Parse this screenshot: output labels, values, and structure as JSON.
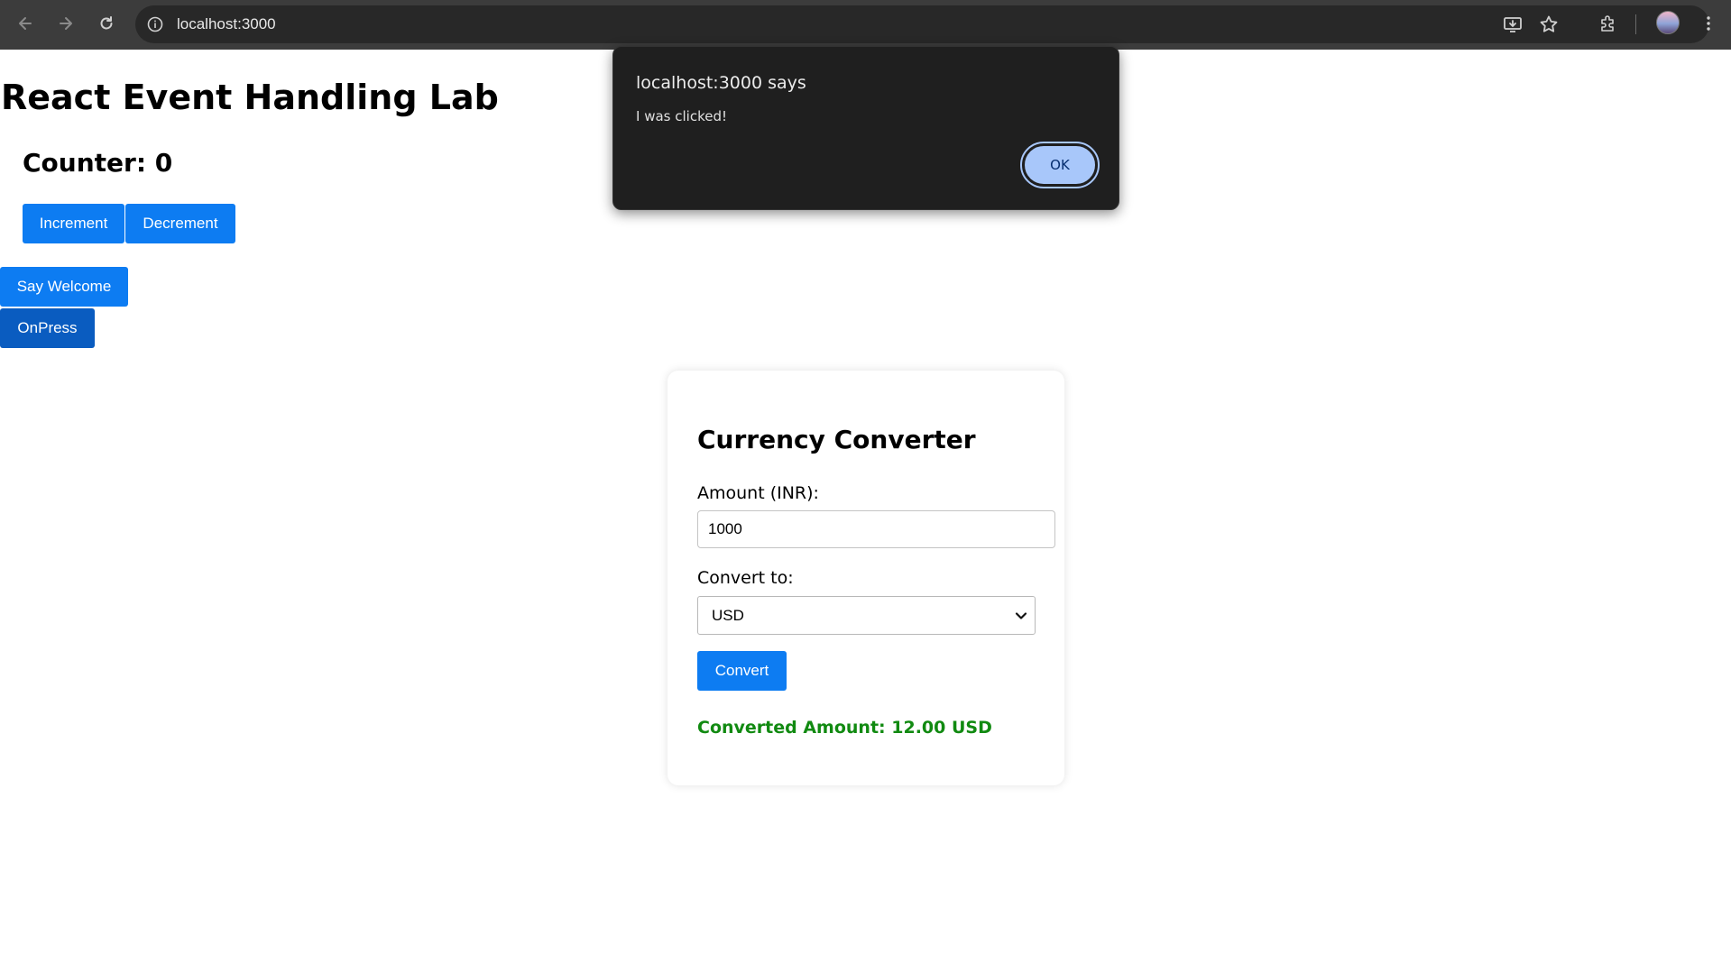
{
  "browser": {
    "url": "localhost:3000",
    "icons": [
      "back-icon",
      "forward-icon",
      "reload-icon",
      "site-info-icon",
      "install-app-icon",
      "bookmark-star-icon",
      "extensions-icon",
      "profile-avatar",
      "more-menu-icon"
    ]
  },
  "page": {
    "title": "React Event Handling Lab",
    "counter_text": "Counter: 0",
    "increment_label": "Increment",
    "decrement_label": "Decrement",
    "say_welcome_label": "Say Welcome",
    "onpress_label": "OnPress"
  },
  "converter": {
    "title": "Currency Converter",
    "amount_label": "Amount (INR):",
    "amount_value": "1000",
    "convert_to_label": "Convert to:",
    "currency_selected": "USD",
    "convert_button": "Convert",
    "result_text": "Converted Amount: 12.00 USD"
  },
  "dialog": {
    "title": "localhost:3000 says",
    "message": "I was clicked!",
    "ok_label": "OK"
  },
  "colors": {
    "primary_button": "#0d7cf2",
    "pressed_button": "#0a5cc0",
    "result_green": "#118a11",
    "dialog_bg": "#1f1f1f",
    "dialog_ok": "#a8c7fa"
  }
}
